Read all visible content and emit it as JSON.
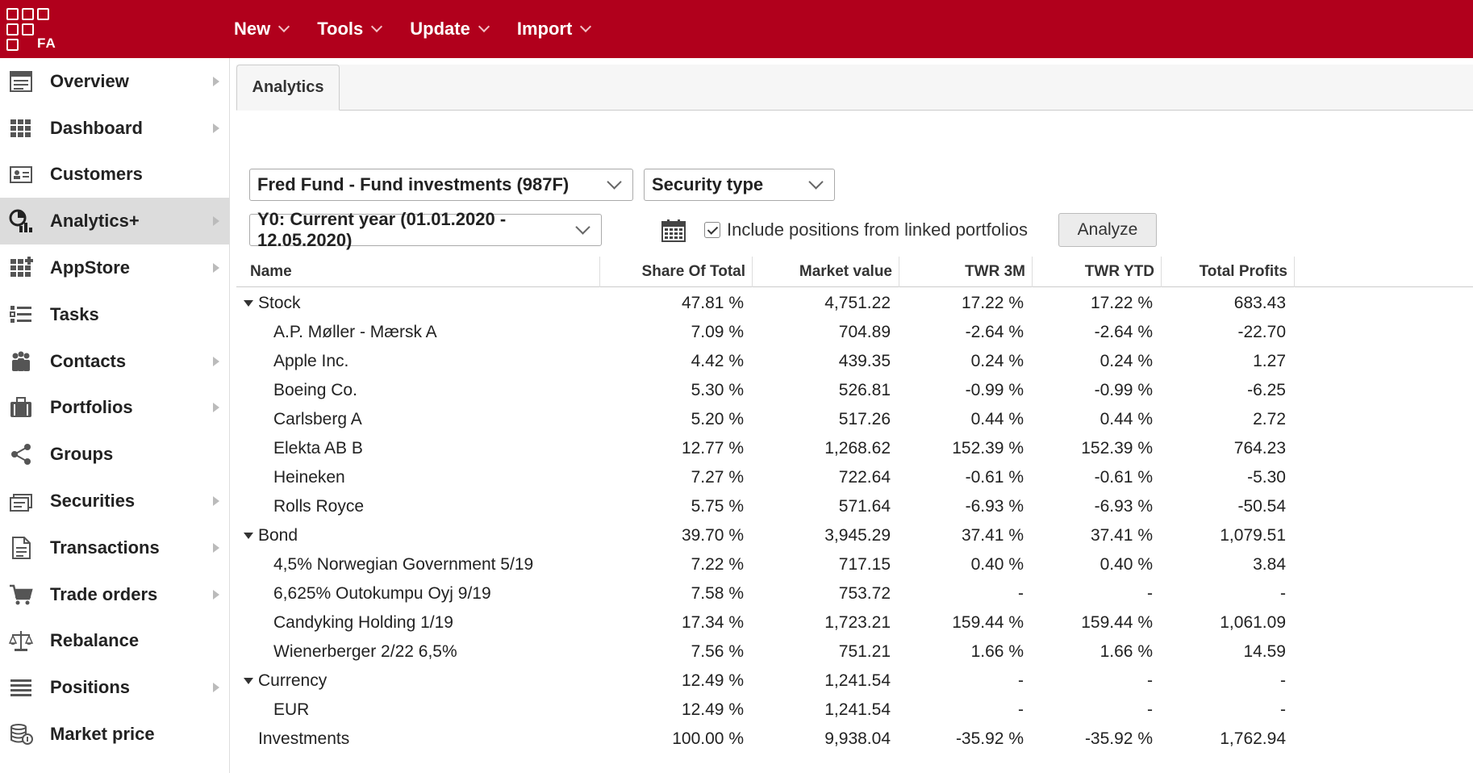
{
  "app": {
    "logo_text": "FA",
    "brand_color": "#b1001c"
  },
  "topnav": [
    {
      "label": "New"
    },
    {
      "label": "Tools"
    },
    {
      "label": "Update"
    },
    {
      "label": "Import"
    }
  ],
  "sidebar": {
    "items": [
      {
        "label": "Overview",
        "icon": "overview-icon",
        "arrow": true,
        "active": false
      },
      {
        "label": "Dashboard",
        "icon": "dashboard-icon",
        "arrow": true,
        "active": false
      },
      {
        "label": "Customers",
        "icon": "customers-icon",
        "arrow": false,
        "active": false
      },
      {
        "label": "Analytics+",
        "icon": "analytics-icon",
        "arrow": true,
        "active": true
      },
      {
        "label": "AppStore",
        "icon": "appstore-icon",
        "arrow": true,
        "active": false
      },
      {
        "label": "Tasks",
        "icon": "tasks-icon",
        "arrow": false,
        "active": false
      },
      {
        "label": "Contacts",
        "icon": "contacts-icon",
        "arrow": true,
        "active": false
      },
      {
        "label": "Portfolios",
        "icon": "portfolios-icon",
        "arrow": true,
        "active": false
      },
      {
        "label": "Groups",
        "icon": "groups-icon",
        "arrow": false,
        "active": false
      },
      {
        "label": "Securities",
        "icon": "securities-icon",
        "arrow": true,
        "active": false
      },
      {
        "label": "Transactions",
        "icon": "transactions-icon",
        "arrow": true,
        "active": false
      },
      {
        "label": "Trade orders",
        "icon": "trade-orders-icon",
        "arrow": true,
        "active": false
      },
      {
        "label": "Rebalance",
        "icon": "rebalance-icon",
        "arrow": false,
        "active": false
      },
      {
        "label": "Positions",
        "icon": "positions-icon",
        "arrow": true,
        "active": false
      },
      {
        "label": "Market price",
        "icon": "market-price-icon",
        "arrow": false,
        "active": false
      }
    ]
  },
  "tab": {
    "label": "Analytics"
  },
  "filters": {
    "portfolio": "Fred Fund - Fund investments (987F)",
    "grouping": "Security type",
    "period": "Y0: Current year (01.01.2020 - 12.05.2020)",
    "include_linked_label": "Include positions from linked portfolios",
    "include_linked_checked": true,
    "analyze_label": "Analyze"
  },
  "table": {
    "columns": [
      "Name",
      "Share Of Total",
      "Market value",
      "TWR 3M",
      "TWR YTD",
      "Total Profits"
    ],
    "rows": [
      {
        "level": 0,
        "expandable": true,
        "cells": [
          "Stock",
          "47.81 %",
          "4,751.22",
          "17.22 %",
          "17.22 %",
          "683.43"
        ]
      },
      {
        "level": 1,
        "expandable": false,
        "cells": [
          "A.P. Møller - Mærsk A",
          "7.09 %",
          "704.89",
          "-2.64 %",
          "-2.64 %",
          "-22.70"
        ]
      },
      {
        "level": 1,
        "expandable": false,
        "cells": [
          "Apple Inc.",
          "4.42 %",
          "439.35",
          "0.24 %",
          "0.24 %",
          "1.27"
        ]
      },
      {
        "level": 1,
        "expandable": false,
        "cells": [
          "Boeing Co.",
          "5.30 %",
          "526.81",
          "-0.99 %",
          "-0.99 %",
          "-6.25"
        ]
      },
      {
        "level": 1,
        "expandable": false,
        "cells": [
          "Carlsberg A",
          "5.20 %",
          "517.26",
          "0.44 %",
          "0.44 %",
          "2.72"
        ]
      },
      {
        "level": 1,
        "expandable": false,
        "cells": [
          "Elekta AB B",
          "12.77 %",
          "1,268.62",
          "152.39 %",
          "152.39 %",
          "764.23"
        ]
      },
      {
        "level": 1,
        "expandable": false,
        "cells": [
          "Heineken",
          "7.27 %",
          "722.64",
          "-0.61 %",
          "-0.61 %",
          "-5.30"
        ]
      },
      {
        "level": 1,
        "expandable": false,
        "cells": [
          "Rolls Royce",
          "5.75 %",
          "571.64",
          "-6.93 %",
          "-6.93 %",
          "-50.54"
        ]
      },
      {
        "level": 0,
        "expandable": true,
        "cells": [
          "Bond",
          "39.70 %",
          "3,945.29",
          "37.41 %",
          "37.41 %",
          "1,079.51"
        ]
      },
      {
        "level": 1,
        "expandable": false,
        "cells": [
          "4,5% Norwegian Government 5/19",
          "7.22 %",
          "717.15",
          "0.40 %",
          "0.40 %",
          "3.84"
        ]
      },
      {
        "level": 1,
        "expandable": false,
        "cells": [
          "6,625% Outokumpu Oyj 9/19",
          "7.58 %",
          "753.72",
          "-",
          "-",
          "-"
        ]
      },
      {
        "level": 1,
        "expandable": false,
        "cells": [
          "Candyking Holding 1/19",
          "17.34 %",
          "1,723.21",
          "159.44 %",
          "159.44 %",
          "1,061.09"
        ]
      },
      {
        "level": 1,
        "expandable": false,
        "cells": [
          "Wienerberger 2/22 6,5%",
          "7.56 %",
          "751.21",
          "1.66 %",
          "1.66 %",
          "14.59"
        ]
      },
      {
        "level": 0,
        "expandable": true,
        "cells": [
          "Currency",
          "12.49 %",
          "1,241.54",
          "-",
          "-",
          "-"
        ]
      },
      {
        "level": 1,
        "expandable": false,
        "cells": [
          "EUR",
          "12.49 %",
          "1,241.54",
          "-",
          "-",
          "-"
        ]
      },
      {
        "level": 0,
        "expandable": false,
        "cells": [
          "Investments",
          "100.00 %",
          "9,938.04",
          "-35.92 %",
          "-35.92 %",
          "1,762.94"
        ]
      }
    ]
  }
}
